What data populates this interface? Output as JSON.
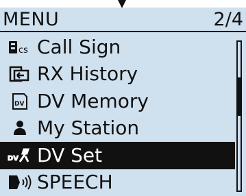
{
  "menu": {
    "title": "MENU",
    "page_indicator": "2/4"
  },
  "items": [
    {
      "label": "Call Sign",
      "icon": "call-sign-icon",
      "icon_text": "cs",
      "selected": false
    },
    {
      "label": "RX History",
      "icon": "rx-history-icon",
      "selected": false
    },
    {
      "label": "DV Memory",
      "icon": "dv-memory-icon",
      "icon_text": "DV",
      "selected": false
    },
    {
      "label": "My Station",
      "icon": "my-station-icon",
      "selected": false
    },
    {
      "label": "DV Set",
      "icon": "dv-set-icon",
      "icon_text": "DV",
      "selected": true
    },
    {
      "label": "SPEECH",
      "icon": "speech-icon",
      "selected": false
    }
  ],
  "scroll": {
    "position_fraction": 0.25
  },
  "colors": {
    "screen_background": "#cfe0ee",
    "foreground": "#111111",
    "selected_text": "#ffffff"
  }
}
